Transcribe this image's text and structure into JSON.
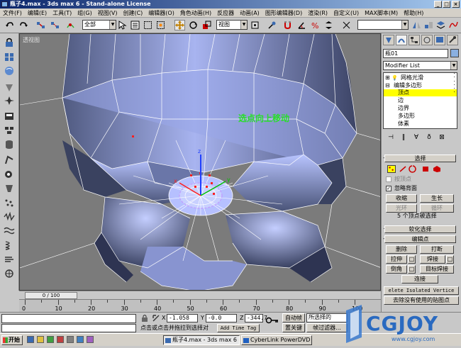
{
  "titlebar": {
    "title": "瓶子4.max - 3ds max 6 - Stand-alone License",
    "minimize": "_",
    "maximize": "□",
    "close": "×"
  },
  "menubar": [
    "文件(F)",
    "编辑(E)",
    "工具(T)",
    "组(G)",
    "视图(V)",
    "创建(C)",
    "编辑器(O)",
    "角色动画(H)",
    "反应器",
    "动画(A)",
    "图形编辑器(D)",
    "渲染(R)",
    "自定义(U)",
    "MAX脚本(M)",
    "帮助(H)"
  ],
  "toolbar": {
    "selection_filter": "全部",
    "ref_coord": "视图",
    "named_sel": ""
  },
  "viewport": {
    "label": "透视图",
    "note": "选点向上移动"
  },
  "cmdpanel": {
    "object_name": "瓶01",
    "modifier_list": "Modifier List",
    "stack": [
      {
        "text": "网格光滑",
        "sign": "⊞",
        "bulb": "💡"
      },
      {
        "text": "编辑多边形",
        "sign": "⊟",
        "bulb": ""
      },
      {
        "text": "顶点",
        "sign": "",
        "bulb": ""
      },
      {
        "text": "边",
        "sign": "",
        "bulb": ""
      },
      {
        "text": "边界",
        "sign": "",
        "bulb": ""
      },
      {
        "text": "多边形",
        "sign": "",
        "bulb": ""
      },
      {
        "text": "体素",
        "sign": "",
        "bulb": ""
      }
    ],
    "rollout_select": "选择",
    "by_vertex": "按顶点",
    "ignore_backface": "忽略背面",
    "shrink": "收缩",
    "grow": "生长",
    "ring": "光环",
    "loop": "循环",
    "sel_info": "5 个顶点被选择",
    "rollout_soft": "软化选择",
    "rollout_edit": "编辑点",
    "remove": "删除",
    "break": "打断",
    "extrude": "拉伸",
    "weld": "焊接",
    "chamfer": "倒角",
    "target_weld": "目标焊接",
    "connect": "连接",
    "delete_isolated": "elete Isolated Vertice",
    "remove_unused_map": "去除没有使用的贴图点",
    "plus": "+",
    "minus": "-"
  },
  "timeline": {
    "frame": "0 / 100",
    "ticks": [
      "0",
      "10",
      "20",
      "30",
      "40",
      "50",
      "60",
      "70",
      "80",
      "90",
      "100"
    ]
  },
  "status": {
    "x_label": "X",
    "y_label": "Y",
    "z_label": "Z",
    "x_val": "-1.058",
    "y_val": "-0.0",
    "z_val": "-344.7",
    "autokey": "自动帧",
    "selected": "所选择的",
    "setkey": "置关键",
    "keyfilter": "帧过滤器...",
    "prompt": "点击或点击并拖拉到选择对",
    "addtimetag": "Add Time Tag"
  },
  "taskbar": {
    "start": "开始",
    "tasks": [
      "瓶子4.max - 3ds max 6 -...",
      "CyberLink PowerDVD"
    ]
  },
  "watermark": {
    "logo": "CGJOY",
    "url": "www.cgjoy.com"
  },
  "colors": {
    "title_gradient_start": "#0a246a",
    "title_gradient_end": "#a6caf0",
    "viewport_bg": "#7b7b7b",
    "stack_highlight": "#ffff00",
    "mesh_blue": "#a0b0f0",
    "vpnote_green": "#28e028"
  }
}
